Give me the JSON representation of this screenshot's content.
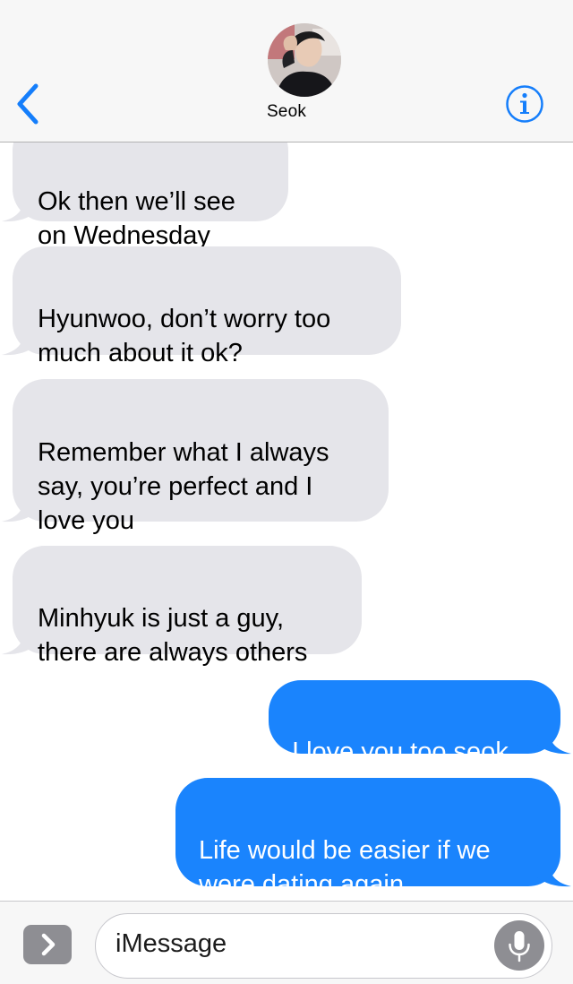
{
  "header": {
    "contact_name": "Seok",
    "back_icon": "chevron-left-icon",
    "info_icon": "info-icon"
  },
  "messages": [
    {
      "from": "contact",
      "text": "Ok then we’ll see\non Wednesday"
    },
    {
      "from": "contact",
      "text": "Hyunwoo, don’t worry too\nmuch about it ok?"
    },
    {
      "from": "contact",
      "text": "Remember what I always\nsay, you’re perfect and I\nlove you"
    },
    {
      "from": "contact",
      "text": "Minhyuk is just a guy,\nthere are always others"
    },
    {
      "from": "me",
      "text": "I love you too seok"
    },
    {
      "from": "me",
      "text": "Life would be easier if we\nwere dating again"
    }
  ],
  "composer": {
    "placeholder": "iMessage",
    "apps_icon": "chevron-right-icon",
    "mic_icon": "microphone-icon"
  },
  "colors": {
    "incoming_bubble": "#e5e5ea",
    "outgoing_bubble": "#1a84fd",
    "accent": "#157efb"
  }
}
